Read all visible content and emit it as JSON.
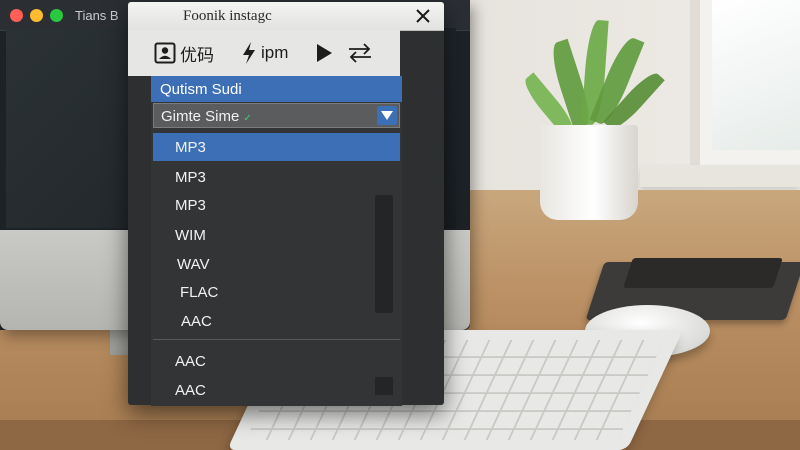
{
  "background_window": {
    "title": "Tians B"
  },
  "app": {
    "title": "Foonik instagc",
    "toolbar": {
      "profile_label": "优码",
      "flash_label": "ipm"
    },
    "profile_row": "Qutism Sudi",
    "select": {
      "value": "Gimte Sime",
      "check": "✓"
    },
    "formats": [
      {
        "label": "MP3",
        "selected": true
      },
      {
        "label": "MP3",
        "selected": false
      },
      {
        "label": "MP3",
        "selected": false
      },
      {
        "label": "WIM",
        "selected": false
      },
      {
        "label": "WAV",
        "selected": false
      },
      {
        "label": "FLAC",
        "selected": false
      },
      {
        "label": "AAC",
        "selected": false
      }
    ],
    "formats_extra": [
      {
        "label": "AAC"
      },
      {
        "label": "AAC"
      }
    ]
  },
  "colors": {
    "accent": "#3d6fb6",
    "panel": "#333436",
    "titlebar": "#e6e6e4"
  },
  "icons": [
    "close-icon",
    "user-icon",
    "flash-icon",
    "play-icon",
    "swap-arrows-icon",
    "chevron-down-icon"
  ]
}
